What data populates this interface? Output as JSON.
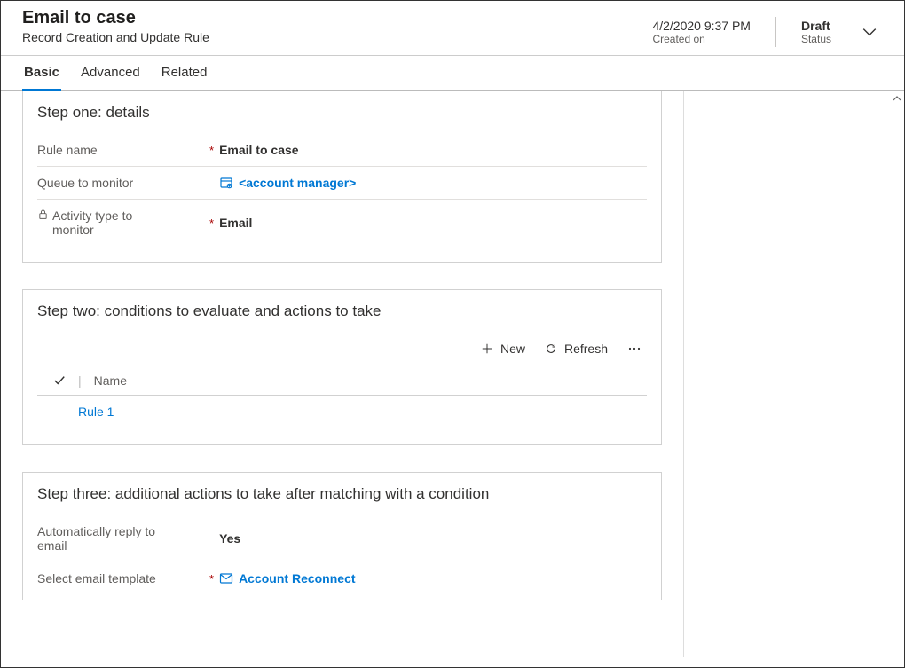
{
  "header": {
    "title": "Email to case",
    "subtitle": "Record Creation and Update Rule",
    "created_value": "4/2/2020 9:37 PM",
    "created_label": "Created on",
    "status_value": "Draft",
    "status_label": "Status"
  },
  "tabs": {
    "basic": "Basic",
    "advanced": "Advanced",
    "related": "Related"
  },
  "step_one": {
    "title": "Step one: details",
    "rule_name_label": "Rule name",
    "rule_name_value": "Email to case",
    "queue_label": "Queue to monitor",
    "queue_value": "<account manager>",
    "activity_label": "Activity type to monitor",
    "activity_value": "Email"
  },
  "step_two": {
    "title": "Step two: conditions to evaluate and actions to take",
    "new_label": "New",
    "refresh_label": "Refresh",
    "grid_header_name": "Name",
    "rows": [
      {
        "name": "Rule 1"
      }
    ]
  },
  "step_three": {
    "title": "Step three: additional actions to take after matching with a condition",
    "auto_reply_label": "Automatically reply to email",
    "auto_reply_value": "Yes",
    "template_label": "Select email template",
    "template_value": "Account Reconnect"
  }
}
